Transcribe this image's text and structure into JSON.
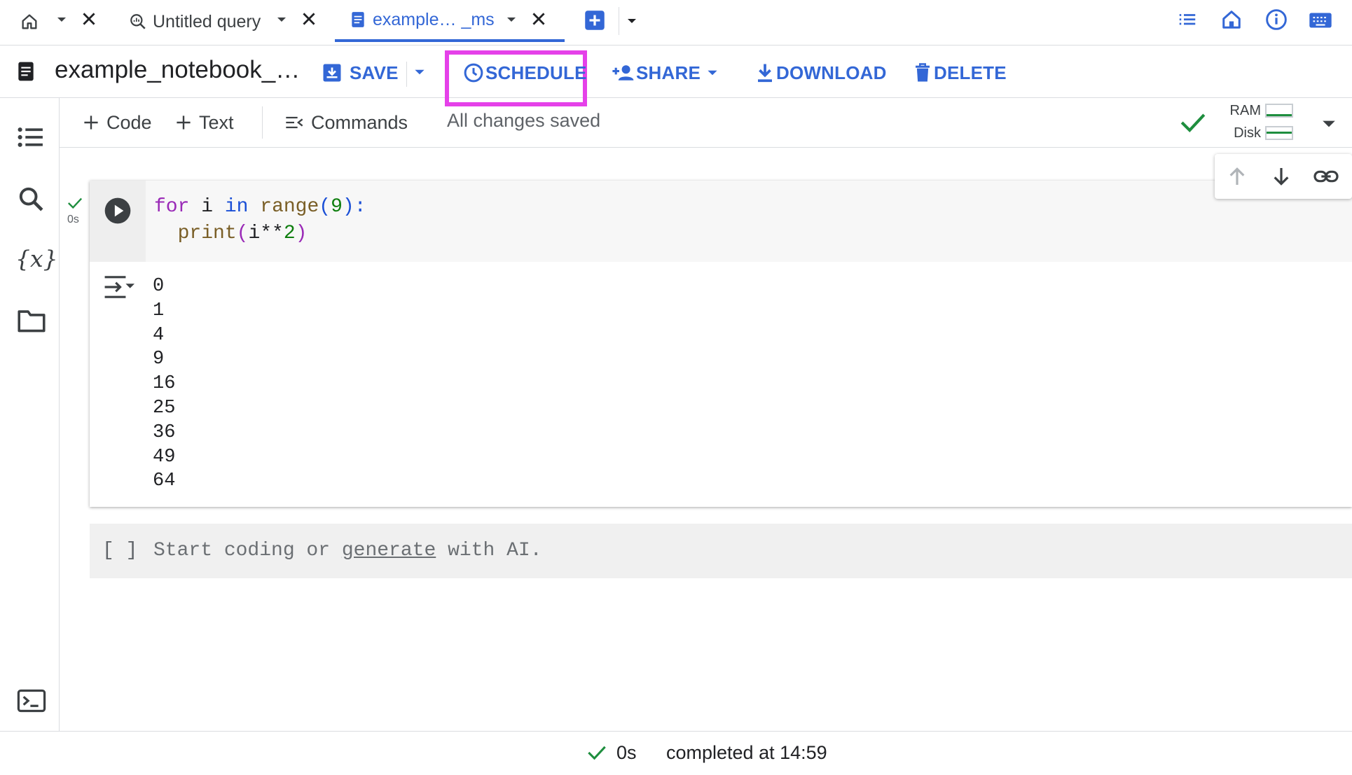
{
  "tabs": [
    {
      "label": "",
      "icon": "home-icon"
    },
    {
      "label": "Untitled query",
      "icon": "query-icon"
    },
    {
      "label": "example… _ms",
      "icon": "notebook-icon",
      "active": true
    }
  ],
  "doc": {
    "title": "example_notebook_…",
    "actions": {
      "save": "SAVE",
      "schedule": "SCHEDULE",
      "share": "SHARE",
      "download": "DOWNLOAD",
      "delete": "DELETE"
    }
  },
  "toolbar": {
    "code": "Code",
    "text": "Text",
    "commands": "Commands",
    "saved_status": "All changes saved",
    "ram_label": "RAM",
    "disk_label": "Disk"
  },
  "cell": {
    "exec_time": "0s",
    "code": {
      "l1_for": "for",
      "l1_var": " i ",
      "l1_in": "in",
      "l1_range": "range",
      "l1_open": "(",
      "l1_num": "9",
      "l1_close": "):",
      "l2_indent": "  ",
      "l2_print": "print",
      "l2_open": "(",
      "l2_expr": "i**",
      "l2_num": "2",
      "l2_close": ")"
    },
    "output": [
      "0",
      "1",
      "4",
      "9",
      "16",
      "25",
      "36",
      "49",
      "64"
    ]
  },
  "empty_cell": {
    "brackets": "[ ]",
    "prefix": "Start coding or ",
    "link": "generate",
    "suffix": " with AI."
  },
  "status": {
    "time": "0s",
    "completed": "completed at 14:59"
  },
  "colors": {
    "accent": "#3367d6",
    "highlight": "#e541e9",
    "success": "#1e8e3e"
  }
}
